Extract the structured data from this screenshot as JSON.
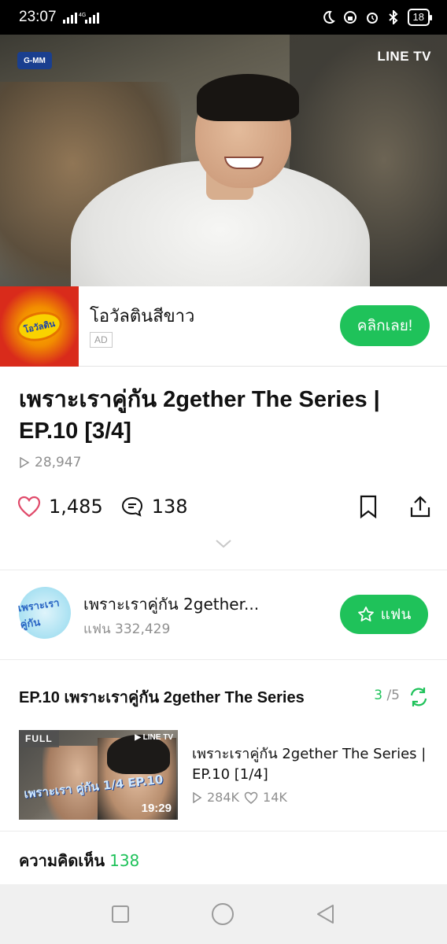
{
  "status_bar": {
    "time": "23:07",
    "network": "4G",
    "battery": "18"
  },
  "video": {
    "channel_logo": "G-MM",
    "brand_logo": "LINE TV"
  },
  "ad": {
    "title": "โอวัลตินสีขาว",
    "badge": "AD",
    "button": "คลิกเลย!",
    "thumb_logo": "โอวัลติน"
  },
  "video_info": {
    "title": "เพราะเราคู่กัน 2gether The Series | EP.10 [3/4]",
    "views": "28,947",
    "likes": "1,485",
    "comments": "138"
  },
  "channel": {
    "name": "เพราะเราคู่กัน 2gether...",
    "fans": "แฟน 332,429",
    "follow_button": "แฟน",
    "avatar_text": "เพราะเรา คู่กัน"
  },
  "episode_list": {
    "heading": "EP.10 เพราะเราคู่กัน 2gether The Series",
    "current": "3",
    "total": "/5",
    "item": {
      "badge": "FULL",
      "thumb_logo": "▶ LINE TV",
      "thumb_title": "เพราะเรา คู่กัน 1/4 EP.10",
      "duration": "19:29",
      "title": "เพราะเราคู่กัน 2gether The Series | EP.10 [1/4]",
      "views": "284K",
      "likes": "14K"
    }
  },
  "comments_section": {
    "label": "ความคิดเห็น",
    "count": "138"
  },
  "colors": {
    "accent": "#1fc25a",
    "like": "#e04a6a",
    "muted": "#8f8f8f"
  }
}
